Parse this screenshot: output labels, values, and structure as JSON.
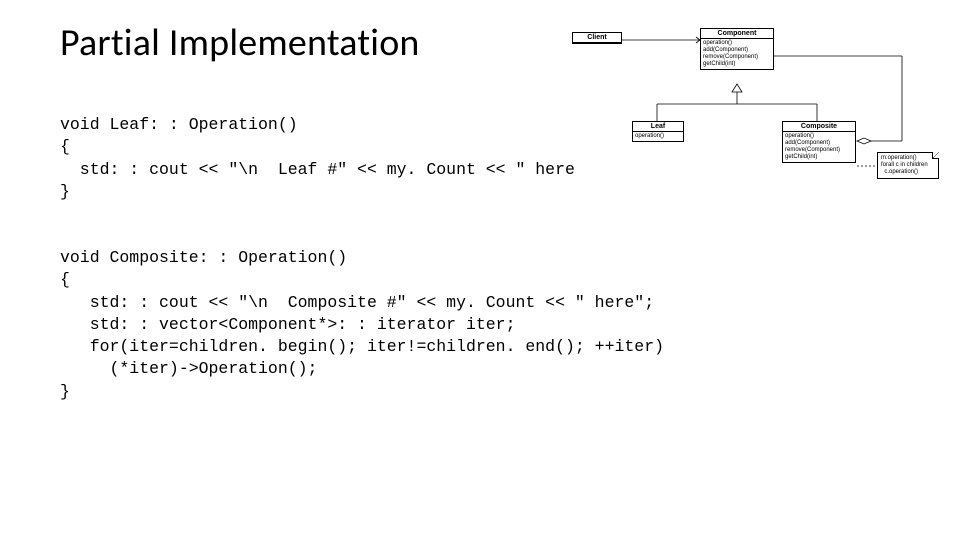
{
  "title": "Partial Implementation",
  "code1": "void Leaf: : Operation()\n{\n  std: : cout << \"\\n  Leaf #\" << my. Count << \" here\n}",
  "code2": "void Composite: : Operation()\n{\n   std: : cout << \"\\n  Composite #\" << my. Count << \" here\";\n   std: : vector<Component*>: : iterator iter;\n   for(iter=children. begin(); iter!=children. end(); ++iter)\n     (*iter)->Operation();\n}",
  "uml": {
    "client": {
      "name": "Client"
    },
    "component": {
      "name": "Component",
      "ops": "operation()\nadd(Component)\nremove(Component)\ngetChild(int)"
    },
    "leaf": {
      "name": "Leaf",
      "ops": "operation()"
    },
    "composite": {
      "name": "Composite",
      "ops": "operation()\nadd(Component)\nremove(Component)\ngetChild(int)"
    },
    "note": "m:operation()\nforall c in children\n  c.operation()"
  }
}
